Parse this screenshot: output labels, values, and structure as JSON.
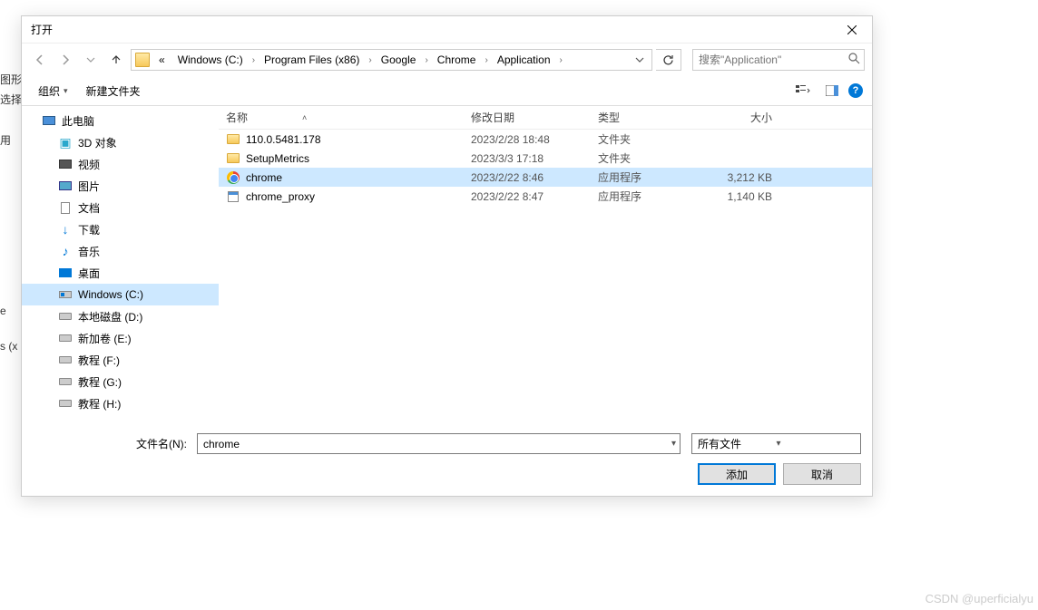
{
  "bg": {
    "t1": "图形",
    "t2": "选择",
    "t3": "用",
    "t4": "e",
    "t5": "s (x"
  },
  "dialog": {
    "title": "打开"
  },
  "breadcrumbs": {
    "prefix": "«",
    "items": [
      "Windows (C:)",
      "Program Files (x86)",
      "Google",
      "Chrome",
      "Application"
    ]
  },
  "search": {
    "placeholder": "搜索\"Application\""
  },
  "toolbar": {
    "organize": "组织",
    "newfolder": "新建文件夹"
  },
  "tree": {
    "items": [
      {
        "label": "此电脑",
        "ico": "ico-pc",
        "sub": false
      },
      {
        "label": "3D 对象",
        "ico": "ico-3d",
        "sub": true,
        "glyph": "▣"
      },
      {
        "label": "视频",
        "ico": "ico-video",
        "sub": true
      },
      {
        "label": "图片",
        "ico": "ico-pic",
        "sub": true
      },
      {
        "label": "文档",
        "ico": "ico-doc",
        "sub": true
      },
      {
        "label": "下载",
        "ico": "ico-dl",
        "sub": true,
        "glyph": "↓"
      },
      {
        "label": "音乐",
        "ico": "ico-music",
        "sub": true,
        "glyph": "♪"
      },
      {
        "label": "桌面",
        "ico": "ico-desk",
        "sub": true
      },
      {
        "label": "Windows (C:)",
        "ico": "ico-win",
        "sub": true,
        "selected": true
      },
      {
        "label": "本地磁盘 (D:)",
        "ico": "ico-drive",
        "sub": true
      },
      {
        "label": "新加卷 (E:)",
        "ico": "ico-drive",
        "sub": true
      },
      {
        "label": "教程 (F:)",
        "ico": "ico-drive",
        "sub": true
      },
      {
        "label": "教程 (G:)",
        "ico": "ico-drive",
        "sub": true
      },
      {
        "label": "教程 (H:)",
        "ico": "ico-drive",
        "sub": true
      }
    ]
  },
  "columns": {
    "name": "名称",
    "date": "修改日期",
    "type": "类型",
    "size": "大小"
  },
  "files": [
    {
      "name": "110.0.5481.178",
      "date": "2023/2/28 18:48",
      "type": "文件夹",
      "size": "",
      "ico": "fico-folder"
    },
    {
      "name": "SetupMetrics",
      "date": "2023/3/3 17:18",
      "type": "文件夹",
      "size": "",
      "ico": "fico-folder"
    },
    {
      "name": "chrome",
      "date": "2023/2/22 8:46",
      "type": "应用程序",
      "size": "3,212 KB",
      "ico": "fico-chrome",
      "selected": true
    },
    {
      "name": "chrome_proxy",
      "date": "2023/2/22 8:47",
      "type": "应用程序",
      "size": "1,140 KB",
      "ico": "fico-exe"
    }
  ],
  "footer": {
    "fname_label": "文件名(N):",
    "fname_value": "chrome",
    "filter": "所有文件",
    "ok": "添加",
    "cancel": "取消"
  },
  "watermark": "CSDN @uperficialyu"
}
